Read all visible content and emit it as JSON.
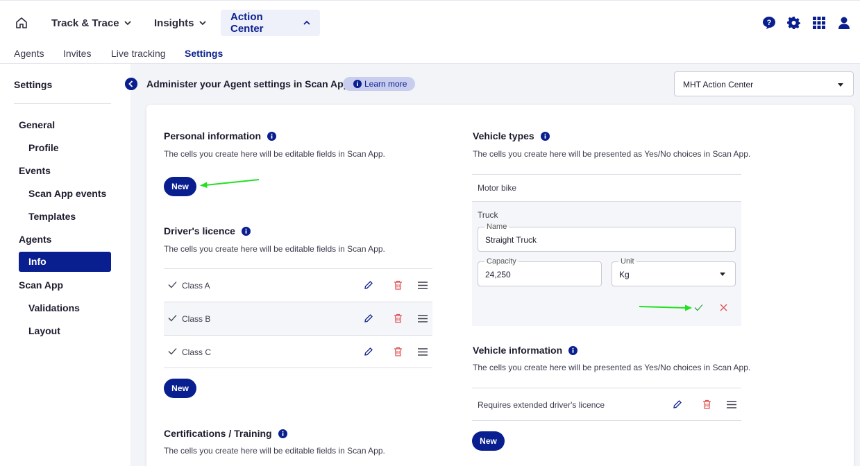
{
  "nav": {
    "track_trace": "Track & Trace",
    "insights": "Insights",
    "action_center": "Action Center"
  },
  "subnav": {
    "agents": "Agents",
    "invites": "Invites",
    "live_tracking": "Live tracking",
    "settings": "Settings"
  },
  "sidebar": {
    "title": "Settings",
    "items": [
      {
        "label": "General"
      },
      {
        "label": "Profile"
      },
      {
        "label": "Events"
      },
      {
        "label": "Scan App events"
      },
      {
        "label": "Templates"
      },
      {
        "label": "Agents"
      },
      {
        "label": "Info"
      },
      {
        "label": "Scan App"
      },
      {
        "label": "Validations"
      },
      {
        "label": "Layout"
      }
    ]
  },
  "header": {
    "title": "Administer your Agent settings in Scan App",
    "learn_more": "Learn more",
    "org_select": "MHT Action Center"
  },
  "personal": {
    "title": "Personal information",
    "desc": "The cells you create here will be editable fields in Scan App.",
    "new": "New"
  },
  "licence": {
    "title": "Driver's licence",
    "desc": "The cells you create here will be editable fields in Scan App.",
    "rows": [
      "Class A",
      "Class B",
      "Class C"
    ],
    "new": "New"
  },
  "certs": {
    "title": "Certifications / Training",
    "desc": "The cells you create here will be editable fields in Scan App."
  },
  "vehicle_types": {
    "title": "Vehicle types",
    "desc": "The cells you create here will be presented as Yes/No choices in Scan App.",
    "motor_bike": "Motor bike",
    "truck": "Truck",
    "name_label": "Name",
    "name_value": "Straight Truck",
    "capacity_label": "Capacity",
    "capacity_value": "24,250",
    "unit_label": "Unit",
    "unit_value": "Kg"
  },
  "vehicle_info": {
    "title": "Vehicle information",
    "desc": "The cells you create here will be presented as Yes/No choices in Scan App.",
    "row": "Requires extended driver's licence",
    "new": "New"
  },
  "colors": {
    "primary": "#0a1f8f",
    "danger": "#e05252",
    "success": "#2fa84f",
    "annotation_arrow": "#22e022"
  }
}
